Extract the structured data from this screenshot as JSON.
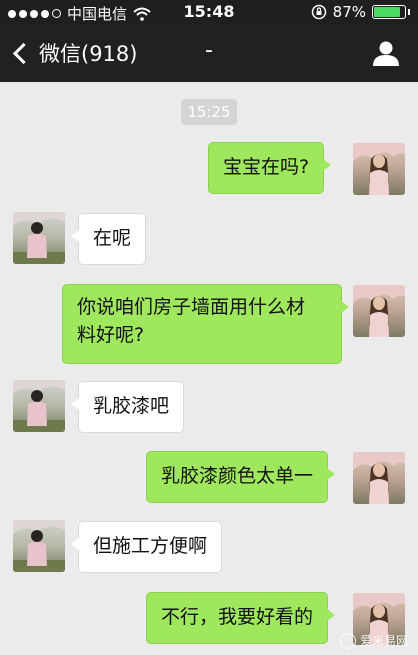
{
  "status_bar": {
    "carrier": "中国电信",
    "time": "15:48",
    "battery_percent": "87%",
    "battery_level": 0.87,
    "signal_bars_filled": 4,
    "signal_bars_total": 5
  },
  "nav": {
    "back_label": "微信(918)",
    "title": "-",
    "profile_icon": "person-icon"
  },
  "chat": {
    "timestamp": "15:25",
    "messages": [
      {
        "side": "out",
        "text": "宝宝在吗?"
      },
      {
        "side": "in",
        "text": "在呢"
      },
      {
        "side": "out",
        "text_line1": "你说咱们房子墙面用什么材",
        "text_line2": "料好呢?"
      },
      {
        "side": "in",
        "text": "乳胶漆吧"
      },
      {
        "side": "out",
        "text": "乳胶漆颜色太单一"
      },
      {
        "side": "in",
        "text": "但施工方便啊"
      },
      {
        "side": "out",
        "text": "不行，我要好看的"
      }
    ]
  },
  "watermark": {
    "text": "爱米易网"
  },
  "colors": {
    "outgoing_bubble": "#9fe85e",
    "incoming_bubble": "#ffffff",
    "nav_bg": "#212121",
    "chat_bg": "#ebebeb"
  }
}
